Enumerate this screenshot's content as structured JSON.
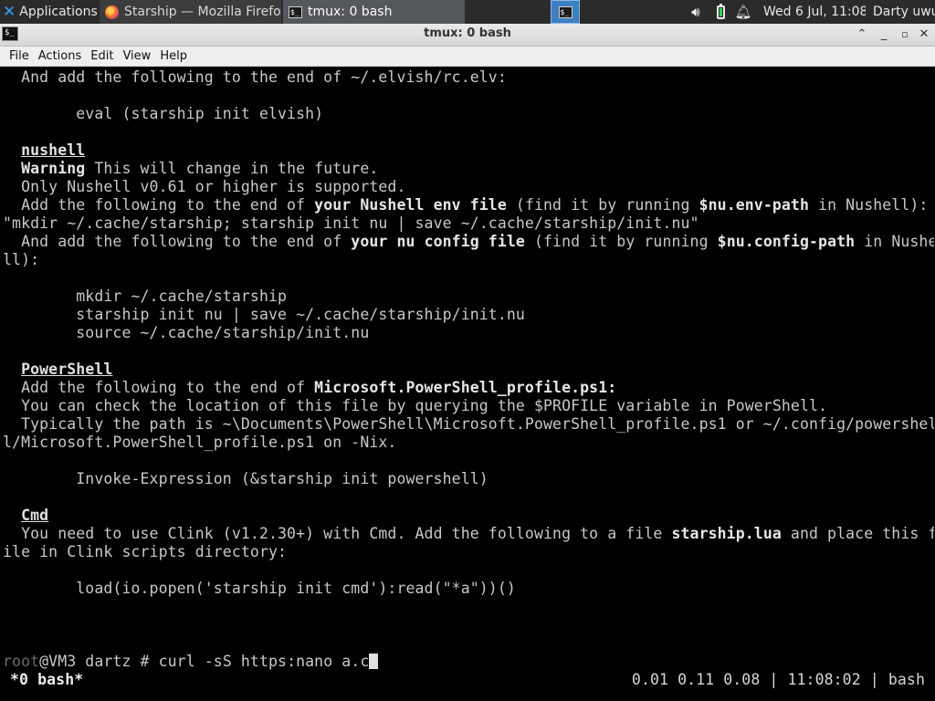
{
  "panel": {
    "applications_label": "Applications",
    "tasks": [
      {
        "label": "Starship — Mozilla Firefox",
        "icon": "firefox-icon",
        "active": false
      },
      {
        "label": "tmux: 0 bash",
        "icon": "terminal-icon",
        "active": true
      }
    ],
    "clock": "Wed  6 Jul, 11:08",
    "user": "Darty uwu"
  },
  "window": {
    "title": "tmux: 0 bash",
    "menu": [
      "File",
      "Actions",
      "Edit",
      "View",
      "Help"
    ]
  },
  "terminal": {
    "lines": [
      "  And add the following to the end of ~/.elvish/rc.elv:",
      "",
      "        eval (starship init elvish)",
      "",
      "  nushell",
      "  Warning This will change in the future.",
      "  Only Nushell v0.61 or higher is supported.",
      "  Add the following to the end of your Nushell env file (find it by running $nu.env-path in Nushell):",
      "\"mkdir ~/.cache/starship; starship init nu | save ~/.cache/starship/init.nu\"",
      "  And add the following to the end of your nu config file (find it by running $nu.config-path in Nushe",
      "ll):",
      "",
      "        mkdir ~/.cache/starship",
      "        starship init nu | save ~/.cache/starship/init.nu",
      "        source ~/.cache/starship/init.nu",
      "",
      "  PowerShell",
      "  Add the following to the end of Microsoft.PowerShell_profile.ps1:",
      "  You can check the location of this file by querying the $PROFILE variable in PowerShell.",
      "  Typically the path is ~\\Documents\\PowerShell\\Microsoft.PowerShell_profile.ps1 or ~/.config/powershel",
      "l/Microsoft.PowerShell_profile.ps1 on -Nix.",
      "",
      "        Invoke-Expression (&starship init powershell)",
      "",
      "  Cmd",
      "  You need to use Clink (v1.2.30+) with Cmd. Add the following to a file starship.lua and place this f",
      "ile in Clink scripts directory:",
      "",
      "        load(io.popen('starship init cmd'):read(\"*a\"))()",
      "",
      "",
      "",
      "root@VM3 dartz # curl -sS https:nano a.c"
    ],
    "headings": [
      "nushell",
      "PowerShell",
      "Cmd"
    ],
    "bold_phrases": [
      "Warning",
      "your Nushell env file",
      "$nu.env-path",
      "your nu config file",
      "$nu.config-path",
      "Microsoft.PowerShell_profile.ps1:",
      "starship.lua"
    ],
    "prompt": {
      "user": "root",
      "rest": "@VM3 dartz # ",
      "command": "curl -sS https:nano a.c"
    },
    "status": {
      "left": "*0 bash*",
      "right": "0.01 0.11 0.08 | 11:08:02 | bash"
    }
  },
  "colors": {
    "accent": "#3d7fc1",
    "battery": "#33d04f"
  }
}
